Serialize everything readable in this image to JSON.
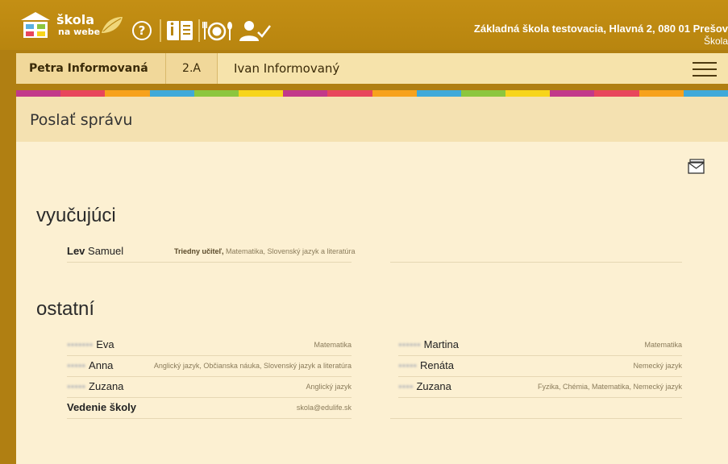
{
  "header": {
    "logo_line1": "škola",
    "logo_line2": "na webe",
    "help_symbol": "?",
    "school_name": "Základná škola testovacia, Hlavná 2, 080 01 Prešov",
    "school_sub": "Škola",
    "icons": [
      "help-icon",
      "info-book-icon",
      "lunch-icon",
      "attendance-user-icon"
    ]
  },
  "userbar": {
    "student": "Petra Informovaná",
    "class": "2.A",
    "parent": "Ivan Informovaný"
  },
  "strip_colors": [
    "#c2398a",
    "#e8465c",
    "#f7a21c",
    "#3fa9d9",
    "#8cc63e",
    "#f7d51b",
    "#c2398a",
    "#e8465c",
    "#f7a21c",
    "#3fa9d9",
    "#8cc63e",
    "#f7d51b",
    "#c2398a",
    "#e8465c",
    "#f7a21c",
    "#3fa9d9"
  ],
  "page": {
    "title": "Poslať správu"
  },
  "vyucujuci": {
    "title": "vyučujúci",
    "rows": [
      {
        "surname": "Lev",
        "given": "Samuel",
        "role": "Triedny učiteľ,",
        "subjects": " Matematika, Slovenský jazyk a literatúra"
      }
    ]
  },
  "ostatni": {
    "title": "ostatní",
    "left": [
      {
        "given": "Eva",
        "subjects": "Matematika"
      },
      {
        "given": "Anna",
        "subjects": "Anglický jazyk, Občianska náuka, Slovenský jazyk a literatúra"
      },
      {
        "given": "Zuzana",
        "subjects": "Anglický jazyk"
      },
      {
        "name": "Vedenie školy",
        "subjects": "skola@edulife.sk"
      }
    ],
    "right": [
      {
        "given": "Martina",
        "subjects": "Matematika"
      },
      {
        "given": "Renáta",
        "subjects": "Nemecký jazyk"
      },
      {
        "given": "Zuzana",
        "subjects": "Fyzika, Chémia, Matematika, Nemecký jazyk"
      }
    ]
  }
}
